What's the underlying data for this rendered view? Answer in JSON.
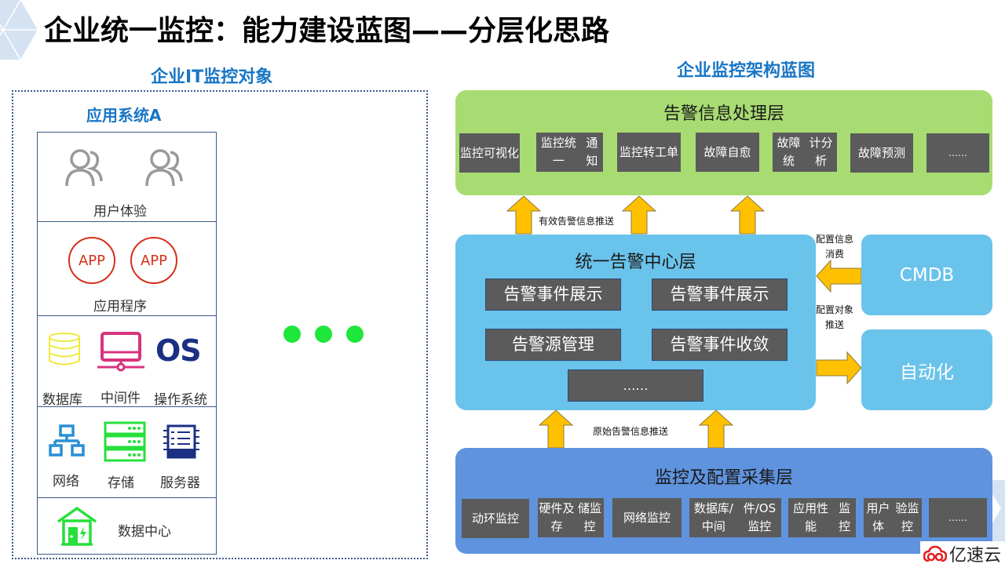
{
  "title": "企业统一监控：能力建设蓝图——分层化思路",
  "left_panel": {
    "heading": "企业IT监控对象",
    "system_title": "应用系统A",
    "cells": [
      {
        "label": "用户体验",
        "icons": [
          "user-group-icon",
          "user-group-icon"
        ]
      },
      {
        "label": "应用程序",
        "icons": [
          "app-icon",
          "app-icon"
        ],
        "icon_text": "APP"
      },
      {
        "items": [
          {
            "label": "数据库",
            "icon": "database-icon"
          },
          {
            "label": "中间件",
            "icon": "middleware-icon"
          },
          {
            "label": "操作系统",
            "icon": "os-icon",
            "icon_text": "OS"
          }
        ]
      },
      {
        "items": [
          {
            "label": "网络",
            "icon": "network-icon"
          },
          {
            "label": "存储",
            "icon": "storage-icon"
          },
          {
            "label": "服务器",
            "icon": "server-icon"
          }
        ]
      },
      {
        "label": "数据中心",
        "icon": "datacenter-icon"
      }
    ],
    "ellipsis_dots": 3
  },
  "right_panel": {
    "heading": "企业监控架构蓝图",
    "top_layer": {
      "title": "告警信息处理层",
      "items": [
        [
          "监控可",
          "视化"
        ],
        [
          "监控统一",
          "通知"
        ],
        [
          "监控转",
          "工单"
        ],
        [
          "故障自",
          "愈"
        ],
        [
          "故障统",
          "计分析"
        ],
        [
          "故障预",
          "测"
        ],
        [
          "……",
          ""
        ]
      ]
    },
    "push_valid_label": "有效告警信息推送",
    "middle_layer": {
      "title": "统一告警中心层",
      "items": [
        "告警事件展示",
        "告警事件展示",
        "告警源管理",
        "告警事件收敛",
        "……"
      ]
    },
    "cmdb": {
      "label": "CMDB",
      "note_line1": "配置信息",
      "note_line2": "消费"
    },
    "automation": {
      "label": "自动化",
      "note_line1": "配置对象",
      "note_line2": "推送"
    },
    "push_raw_label": "原始告警信息推送",
    "bottom_layer": {
      "title": "监控及配置采集层",
      "items": [
        [
          "动环监控",
          ""
        ],
        [
          "硬件及存",
          "储监控"
        ],
        [
          "网络监控",
          ""
        ],
        [
          "数据库/中间",
          "件/OS监控"
        ],
        [
          "应用性能",
          "监控"
        ],
        [
          "用户体",
          "验监控"
        ],
        [
          "……",
          ""
        ]
      ]
    }
  },
  "colors": {
    "title_blue": "#1976c6",
    "top_layer_green": "#a8dc72",
    "middle_layer_blue": "#6ac3eb",
    "bottom_layer_blue": "#5f93de",
    "box_gray": "#5b5b5b",
    "arrow_gold": "#ffc000",
    "dot_green": "#1ee63c"
  },
  "watermark": {
    "brand_text": "亿速云"
  }
}
